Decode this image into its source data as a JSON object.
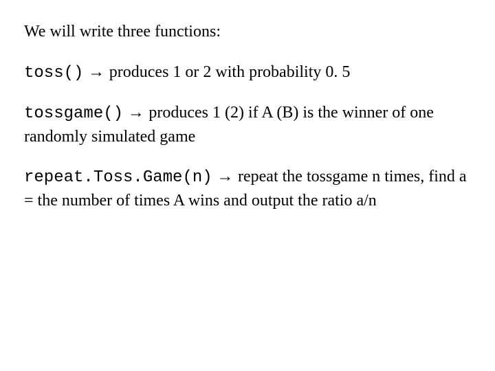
{
  "heading": "We will write three functions:",
  "items": [
    {
      "code": "toss()",
      "arrow": " → ",
      "desc": "produces 1 or 2 with probability 0. 5"
    },
    {
      "code": "tossgame()",
      "arrow": " → ",
      "desc": "produces 1 (2) if A (B) is the winner of one randomly simulated game"
    },
    {
      "code": "repeat.Toss.Game(n)",
      "arrow": " → ",
      "desc": "repeat the tossgame n times, find a = the number of times A wins and output the ratio a/n"
    }
  ]
}
